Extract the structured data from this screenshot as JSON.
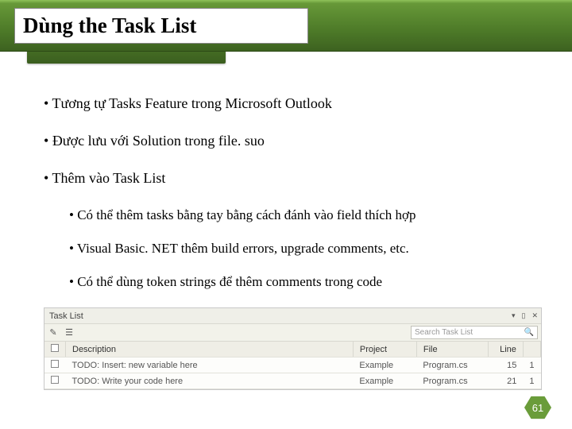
{
  "title": "Dùng the Task List",
  "bullets": {
    "b0": "Tương tự Tasks Feature trong Microsoft Outlook",
    "b1": "Được lưu với Solution trong file. suo",
    "b2": "Thêm vào Task List",
    "s0": "Có thể thêm tasks bằng tay bằng cách đánh vào field thích hợp",
    "s1": "Visual Basic. NET thêm build errors, upgrade comments, etc.",
    "s2": "Có thể dùng token strings để thêm comments trong code"
  },
  "panel": {
    "title": "Task List",
    "search_placeholder": "Search Task List",
    "headers": {
      "desc": "Description",
      "proj": "Project",
      "file": "File",
      "line": "Line"
    },
    "rows": [
      {
        "desc": "TODO: Insert: new variable here",
        "proj": "Example",
        "file": "Program.cs",
        "line": "15",
        "x": "1"
      },
      {
        "desc": "TODO: Write your code here",
        "proj": "Example",
        "file": "Program.cs",
        "line": "21",
        "x": "1"
      }
    ]
  },
  "page_number": "61"
}
